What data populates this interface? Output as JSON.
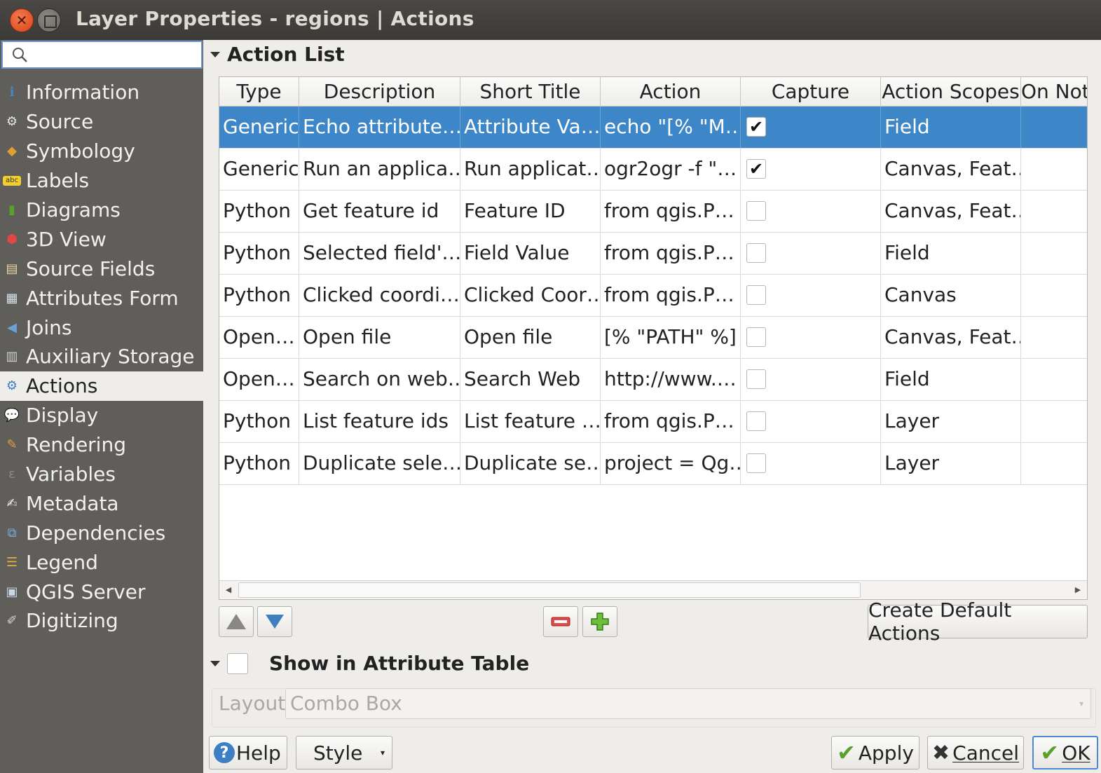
{
  "window": {
    "title": "Layer Properties - regions | Actions"
  },
  "search": {
    "placeholder": ""
  },
  "sidebar": {
    "items": [
      {
        "label": "Information",
        "icon": "info-icon",
        "glyph": "ℹ",
        "color": "#4a86c8"
      },
      {
        "label": "Source",
        "icon": "source-settings-icon",
        "glyph": "⚙",
        "color": "#e6e6e6"
      },
      {
        "label": "Symbology",
        "icon": "symbology-icon",
        "glyph": "◆",
        "color": "#e0a030"
      },
      {
        "label": "Labels",
        "icon": "labels-icon",
        "glyph": "abc",
        "color": "#f1cf2f"
      },
      {
        "label": "Diagrams",
        "icon": "diagrams-icon",
        "glyph": "▮",
        "color": "#5aa02c"
      },
      {
        "label": "3D View",
        "icon": "3d-view-icon",
        "glyph": "⬢",
        "color": "#e04848"
      },
      {
        "label": "Source Fields",
        "icon": "source-fields-icon",
        "glyph": "▤",
        "color": "#e8d9a0"
      },
      {
        "label": "Attributes Form",
        "icon": "attributes-form-icon",
        "glyph": "▦",
        "color": "#d8e4f0"
      },
      {
        "label": "Joins",
        "icon": "joins-icon",
        "glyph": "◀",
        "color": "#6aa2d8"
      },
      {
        "label": "Auxiliary Storage",
        "icon": "auxiliary-storage-icon",
        "glyph": "▥",
        "color": "#d0d0d0"
      },
      {
        "label": "Actions",
        "icon": "actions-gear-icon",
        "glyph": "⚙",
        "color": "#3a7ec0"
      },
      {
        "label": "Display",
        "icon": "display-tooltip-icon",
        "glyph": "💬",
        "color": "#f1d36a"
      },
      {
        "label": "Rendering",
        "icon": "rendering-brush-icon",
        "glyph": "✎",
        "color": "#e0a040"
      },
      {
        "label": "Variables",
        "icon": "variables-icon",
        "glyph": "ε",
        "color": "#8a8a8a"
      },
      {
        "label": "Metadata",
        "icon": "metadata-icon",
        "glyph": "✍",
        "color": "#f0f0f0"
      },
      {
        "label": "Dependencies",
        "icon": "dependencies-icon",
        "glyph": "⧉",
        "color": "#7aa8d8"
      },
      {
        "label": "Legend",
        "icon": "legend-icon",
        "glyph": "☰",
        "color": "#e0b040"
      },
      {
        "label": "QGIS Server",
        "icon": "qgis-server-icon",
        "glyph": "▣",
        "color": "#c8d8e8"
      },
      {
        "label": "Digitizing",
        "icon": "digitizing-icon",
        "glyph": "✐",
        "color": "#d8d8d8"
      }
    ]
  },
  "action_list": {
    "title": "Action List",
    "columns": [
      "Type",
      "Description",
      "Short Title",
      "Action",
      "Capture",
      "Action Scopes",
      "On Not"
    ],
    "rows": [
      {
        "type": "Generic",
        "description": "Echo attribute…",
        "short_title": "Attribute Va…",
        "action": "echo \"[% \"M…",
        "capture": true,
        "scopes": "Field",
        "on_notification": ""
      },
      {
        "type": "Generic",
        "description": "Run an applica…",
        "short_title": "Run applicat…",
        "action": "ogr2ogr -f \"…",
        "capture": true,
        "scopes": "Canvas, Feat…",
        "on_notification": ""
      },
      {
        "type": "Python",
        "description": "Get feature id",
        "short_title": "Feature ID",
        "action": "from qgis.P…",
        "capture": false,
        "scopes": "Canvas, Feat…",
        "on_notification": ""
      },
      {
        "type": "Python",
        "description": "Selected field'…",
        "short_title": "Field Value",
        "action": "from qgis.P…",
        "capture": false,
        "scopes": "Field",
        "on_notification": ""
      },
      {
        "type": "Python",
        "description": "Clicked coordi…",
        "short_title": "Clicked Coor…",
        "action": "from qgis.P…",
        "capture": false,
        "scopes": "Canvas",
        "on_notification": ""
      },
      {
        "type": "Open…",
        "description": "Open file",
        "short_title": "Open file",
        "action": "[% \"PATH\" %]",
        "capture": false,
        "scopes": "Canvas, Feat…",
        "on_notification": ""
      },
      {
        "type": "Open…",
        "description": "Search on web…",
        "short_title": "Search Web",
        "action": "http://www.…",
        "capture": false,
        "scopes": "Field",
        "on_notification": ""
      },
      {
        "type": "Python",
        "description": "List feature ids",
        "short_title": "List feature …",
        "action": "from qgis.P…",
        "capture": false,
        "scopes": "Layer",
        "on_notification": ""
      },
      {
        "type": "Python",
        "description": "Duplicate sele…",
        "short_title": "Duplicate se…",
        "action": "project = Qg…",
        "capture": false,
        "scopes": "Layer",
        "on_notification": ""
      }
    ],
    "selected_row": 0,
    "check_glyph": "✔",
    "create_default_label": "Create Default Actions"
  },
  "attribute_table": {
    "title": "Show in Attribute Table",
    "checked": false,
    "layout_label": "Layout",
    "layout_value": "Combo Box"
  },
  "footer": {
    "help_label": "Help",
    "style_label": "Style",
    "apply_label": "Apply",
    "cancel_label": "Cancel",
    "ok_label": "OK"
  },
  "colors": {
    "selection": "#3d87c8",
    "sidebar": "#5f5e5a",
    "titlebar": "#3b3a37",
    "accent_check": "#5aa02c"
  }
}
